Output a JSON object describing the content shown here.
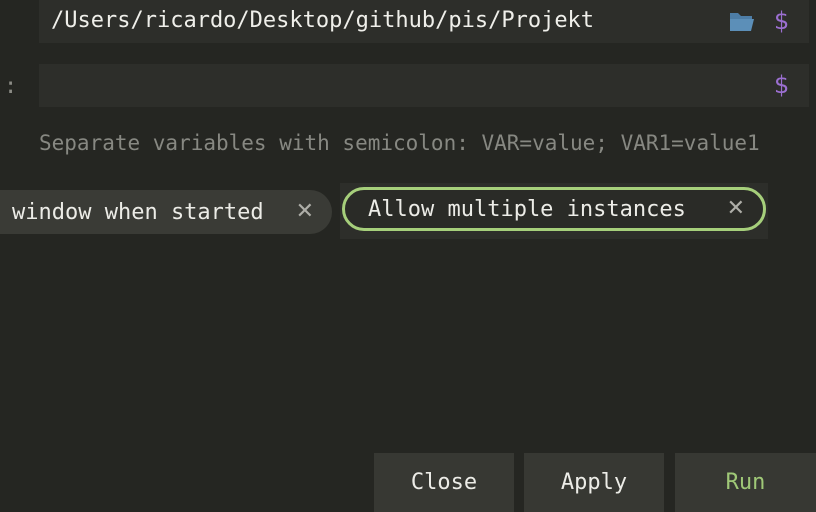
{
  "working_directory": {
    "value": "/Users/ricardo/Desktop/github/pis/Projekt",
    "icons": [
      "folder-open-icon",
      "dollar-icon"
    ]
  },
  "environment": {
    "label_fragment": ":",
    "value": "",
    "icons": [
      "dollar-icon"
    ],
    "hint": "Separate variables with semicolon: VAR=value; VAR1=value1"
  },
  "options": [
    {
      "label": "window when started",
      "selected": false
    },
    {
      "label": "Allow multiple instances",
      "selected": true
    }
  ],
  "chip_close_glyph": "✕",
  "buttons": {
    "close": "Close",
    "apply": "Apply",
    "run": "Run"
  },
  "colors": {
    "background": "#252622",
    "field": "#2d2e2a",
    "accent_purple": "#9b6fd0",
    "accent_green": "#a6cf7b",
    "folder_blue": "#5c8fb8"
  }
}
